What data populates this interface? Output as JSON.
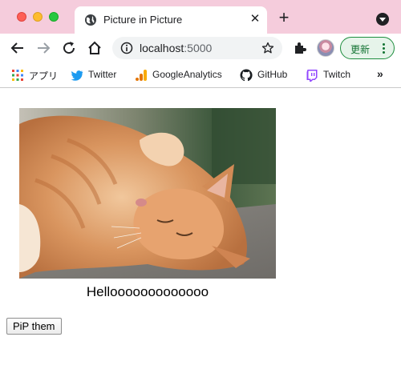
{
  "tab": {
    "title": "Picture in Picture",
    "close_glyph": "✕"
  },
  "new_tab_glyph": "+",
  "omnibox": {
    "host": "localhost",
    "port": ":5000"
  },
  "update_button": {
    "label": "更新"
  },
  "bookmarks": {
    "items": [
      {
        "label": "アプリ",
        "icon": "apps-grid-icon"
      },
      {
        "label": "Twitter",
        "icon": "twitter-icon"
      },
      {
        "label": "GoogleAnalytics",
        "icon": "analytics-icon"
      },
      {
        "label": "GitHub",
        "icon": "github-icon"
      },
      {
        "label": "Twitch",
        "icon": "twitch-icon"
      }
    ],
    "more_glyph": "»"
  },
  "page": {
    "image_alt": "cat",
    "caption": "Hellooooooooooooo",
    "pip_button": "PiP them"
  },
  "colors": {
    "tabstrip": "#f5ccdc",
    "update_accent": "#1e8e3e"
  }
}
